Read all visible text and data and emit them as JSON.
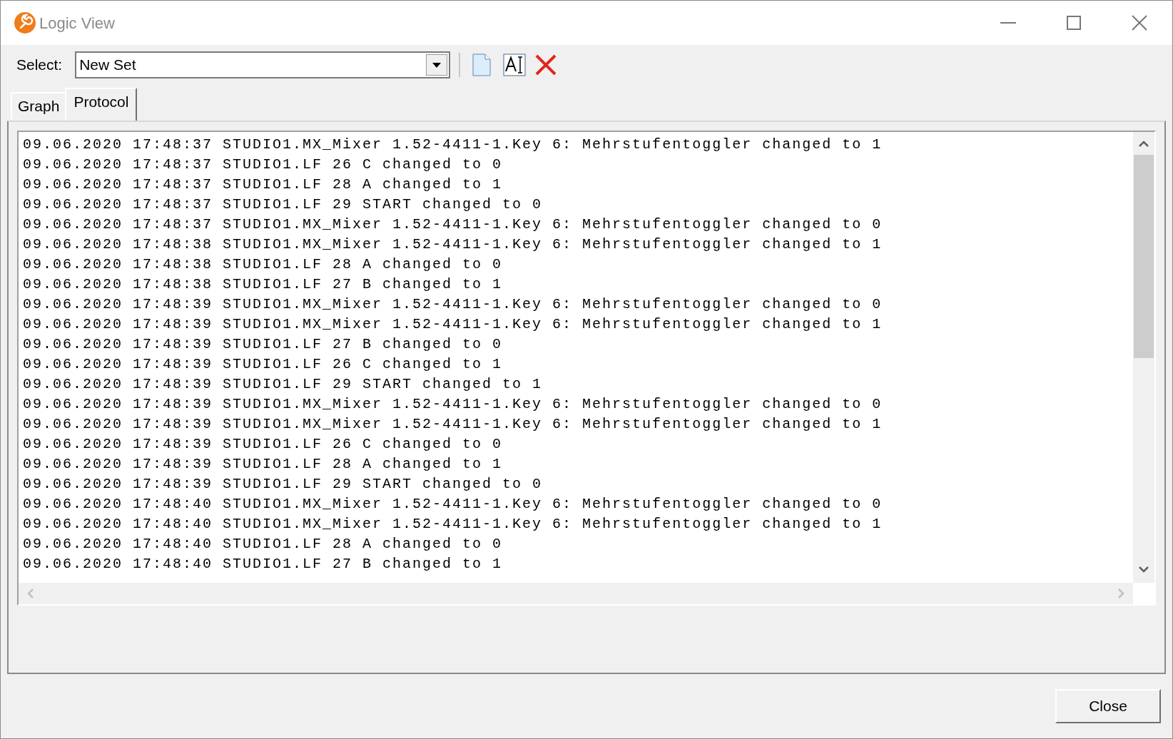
{
  "window": {
    "title": "Logic View"
  },
  "toolbar": {
    "select_label": "Select:",
    "select_value": "New Set"
  },
  "tabs": [
    {
      "label": "Graph",
      "selected": false
    },
    {
      "label": "Protocol",
      "selected": true
    }
  ],
  "protocol_lines": [
    "09.06.2020 17:48:37 STUDIO1.MX_Mixer 1.52-4411-1.Key 6: Mehrstufentoggler changed to 1",
    "09.06.2020 17:48:37 STUDIO1.LF 26 C changed to 0",
    "09.06.2020 17:48:37 STUDIO1.LF 28 A changed to 1",
    "09.06.2020 17:48:37 STUDIO1.LF 29 START changed to 0",
    "09.06.2020 17:48:37 STUDIO1.MX_Mixer 1.52-4411-1.Key 6: Mehrstufentoggler changed to 0",
    "09.06.2020 17:48:38 STUDIO1.MX_Mixer 1.52-4411-1.Key 6: Mehrstufentoggler changed to 1",
    "09.06.2020 17:48:38 STUDIO1.LF 28 A changed to 0",
    "09.06.2020 17:48:38 STUDIO1.LF 27 B changed to 1",
    "09.06.2020 17:48:39 STUDIO1.MX_Mixer 1.52-4411-1.Key 6: Mehrstufentoggler changed to 0",
    "09.06.2020 17:48:39 STUDIO1.MX_Mixer 1.52-4411-1.Key 6: Mehrstufentoggler changed to 1",
    "09.06.2020 17:48:39 STUDIO1.LF 27 B changed to 0",
    "09.06.2020 17:48:39 STUDIO1.LF 26 C changed to 1",
    "09.06.2020 17:48:39 STUDIO1.LF 29 START changed to 1",
    "09.06.2020 17:48:39 STUDIO1.MX_Mixer 1.52-4411-1.Key 6: Mehrstufentoggler changed to 0",
    "09.06.2020 17:48:39 STUDIO1.MX_Mixer 1.52-4411-1.Key 6: Mehrstufentoggler changed to 1",
    "09.06.2020 17:48:39 STUDIO1.LF 26 C changed to 0",
    "09.06.2020 17:48:39 STUDIO1.LF 28 A changed to 1",
    "09.06.2020 17:48:39 STUDIO1.LF 29 START changed to 0",
    "09.06.2020 17:48:40 STUDIO1.MX_Mixer 1.52-4411-1.Key 6: Mehrstufentoggler changed to 0",
    "09.06.2020 17:48:40 STUDIO1.MX_Mixer 1.52-4411-1.Key 6: Mehrstufentoggler changed to 1",
    "09.06.2020 17:48:40 STUDIO1.LF 28 A changed to 0",
    "09.06.2020 17:48:40 STUDIO1.LF 27 B changed to 1"
  ],
  "buttons": [
    "Close"
  ]
}
